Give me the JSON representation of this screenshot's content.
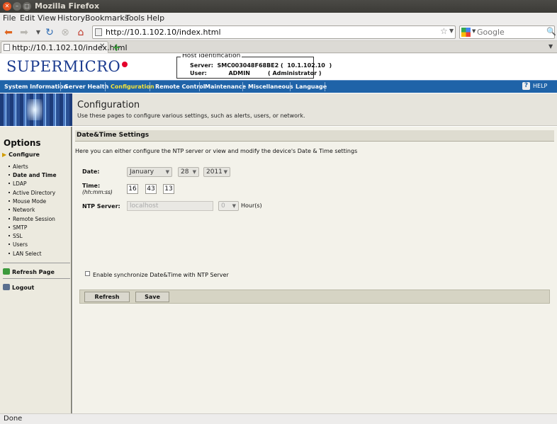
{
  "window": {
    "title": "Mozilla Firefox"
  },
  "menubar": [
    "File",
    "Edit",
    "View",
    "History",
    "Bookmarks",
    "Tools",
    "Help"
  ],
  "navbar": {
    "url": "http://10.1.102.10/index.html",
    "search_placeholder": "Google"
  },
  "tab": {
    "label": "http://10.1.102.10/index.html"
  },
  "page": {
    "logo": "SUPERMICRO",
    "host": {
      "legend": "Host Identification",
      "server_row": "Server:  SMC003048F68BE2 (  10.1.102.10  )",
      "user_row": "User:           ADMIN         ( Administrator )"
    },
    "menu": [
      {
        "label": "System Information",
        "active": false
      },
      {
        "label": "Server Health",
        "active": false
      },
      {
        "label": "Configuration",
        "active": true
      },
      {
        "label": "Remote Control",
        "active": false
      },
      {
        "label": "Maintenance",
        "active": false
      },
      {
        "label": "Miscellaneous",
        "active": false
      },
      {
        "label": "Language",
        "active": false
      }
    ],
    "help": "HELP",
    "banner": {
      "title": "Configuration",
      "subtitle": "Use these pages to configure various settings, such as alerts, users, or network."
    },
    "sidebar": {
      "heading": "Options",
      "group": "Configure",
      "items": [
        "Alerts",
        "Date and Time",
        "LDAP",
        "Active Directory",
        "Mouse Mode",
        "Network",
        "Remote Session",
        "SMTP",
        "SSL",
        "Users",
        "LAN Select"
      ],
      "refresh": "Refresh Page",
      "logout": "Logout"
    },
    "main": {
      "section_title": "Date&Time Settings",
      "intro": "Here you can either configure the NTP server or view and modify the device's Date & Time settings",
      "date_label": "Date:",
      "month": "January",
      "day": "28",
      "year": "2011",
      "time_label": "Time:",
      "time_hint": "(hh:mm:ss)",
      "hour": "16",
      "minute": "43",
      "second": "13",
      "ntp_label": "NTP Server:",
      "ntp_value": "localhost",
      "ntp_hours": "0",
      "ntp_hours_unit": "Hour(s)",
      "sync_label": "Enable synchronize Date&Time with NTP Server",
      "refresh_button": "Refresh",
      "save_button": "Save"
    }
  },
  "status": "Done"
}
